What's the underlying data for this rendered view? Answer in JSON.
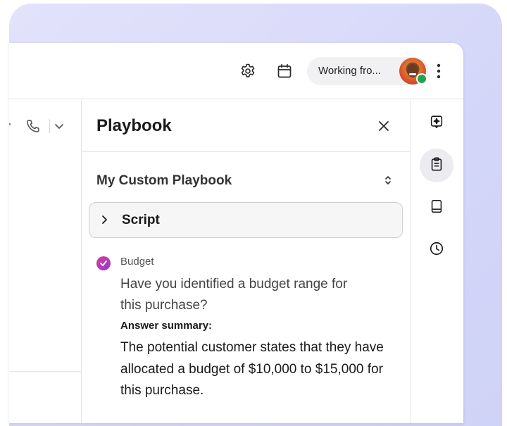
{
  "topbar": {
    "status_text": "Working fro...",
    "icons": [
      "settings-gear-icon",
      "calendar-icon",
      "more-vertical-icon"
    ]
  },
  "left_toolbar": {
    "icons": [
      "phone-icon",
      "chevron-down-icon"
    ]
  },
  "playbook": {
    "title": "Playbook",
    "selector_label": "My Custom Playbook",
    "script_label": "Script",
    "question": {
      "tag": "Budget",
      "text": "Have you identified a budget range for this purchase?",
      "answer_label": "Answer summary:",
      "answer_text": "The potential customer states that they have allocated a budget of $10,000 to $15,000 for this purchase."
    }
  },
  "right_rail": {
    "items": [
      "ai-assist-icon",
      "clipboard-icon",
      "book-icon",
      "clock-icon"
    ]
  },
  "colors": {
    "background_gradient_start": "#e3e2fb",
    "background_gradient_end": "#cfd3f7",
    "presence_green": "#21a54a",
    "check_gradient_start": "#e0379a",
    "check_gradient_end": "#8e3bd6"
  }
}
